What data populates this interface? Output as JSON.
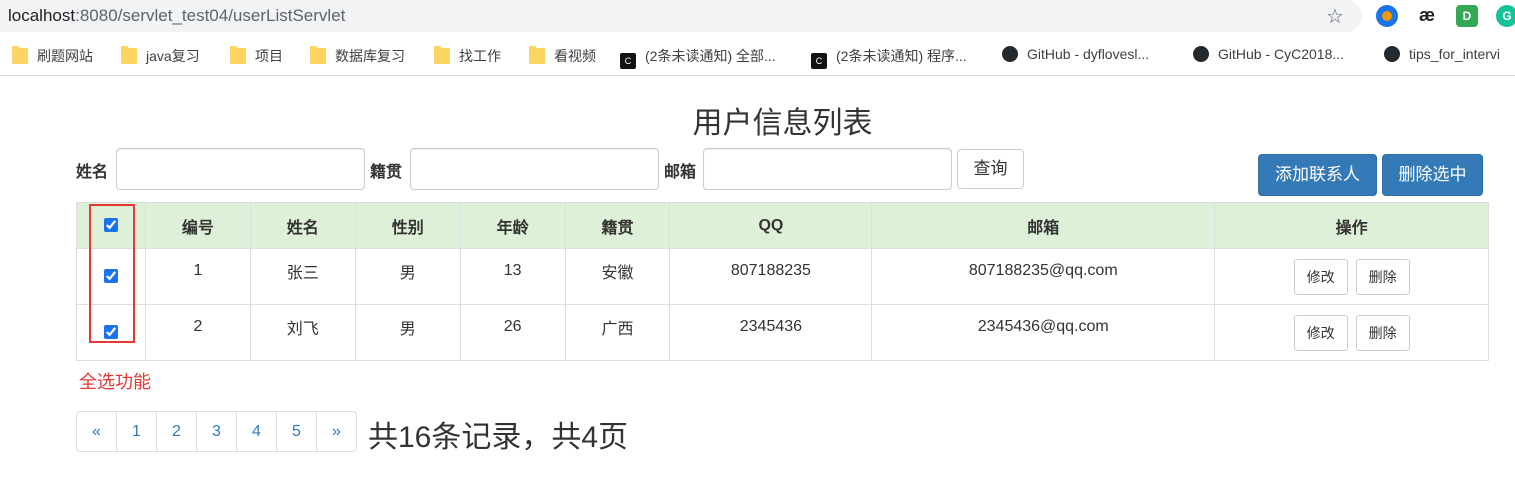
{
  "browser": {
    "url_host": "localhost",
    "url_rest": ":8080/servlet_test04/userListServlet",
    "bookmarks": [
      {
        "label": "刷题网站",
        "icon": "folder-icon"
      },
      {
        "label": "java复习",
        "icon": "folder-icon"
      },
      {
        "label": "项目",
        "icon": "folder-icon"
      },
      {
        "label": "数据库复习",
        "icon": "folder-icon"
      },
      {
        "label": "找工作",
        "icon": "folder-icon"
      },
      {
        "label": "看视频",
        "icon": "folder-icon"
      },
      {
        "label": "(2条未读通知) 全部...",
        "icon": "csdn-icon"
      },
      {
        "label": "(2条未读通知) 程序...",
        "icon": "csdn-icon"
      },
      {
        "label": "GitHub - dyflovesl...",
        "icon": "github-icon"
      },
      {
        "label": "GitHub - CyC2018...",
        "icon": "github-icon"
      },
      {
        "label": "tips_for_intervi",
        "icon": "github-icon"
      }
    ]
  },
  "page": {
    "title": "用户信息列表",
    "search": {
      "name_label": "姓名",
      "origin_label": "籍贯",
      "email_label": "邮箱",
      "query_button": "查询"
    },
    "add_button": "添加联系人",
    "delete_selected_button": "删除选中"
  },
  "table": {
    "headers": [
      "编号",
      "姓名",
      "性别",
      "年龄",
      "籍贯",
      "QQ",
      "邮箱",
      "操作"
    ],
    "rows": [
      {
        "id": "1",
        "name": "张三",
        "gender": "男",
        "age": "13",
        "origin": "安徽",
        "qq": "807188235",
        "email": "807188235@qq.com",
        "checked": true
      },
      {
        "id": "2",
        "name": "刘飞",
        "gender": "男",
        "age": "26",
        "origin": "广西",
        "qq": "2345436",
        "email": "2345436@qq.com",
        "checked": true
      }
    ],
    "edit_label": "修改",
    "delete_label": "删除",
    "select_all_checked": true
  },
  "annotation": "全选功能",
  "pagination": {
    "prev": "«",
    "pages": [
      "1",
      "2",
      "3",
      "4",
      "5"
    ],
    "next": "»",
    "summary": "共16条记录，共4页"
  },
  "colors": {
    "header_row": "#dff0d8",
    "primary": "#337ab7",
    "annotation": "#e53935"
  }
}
